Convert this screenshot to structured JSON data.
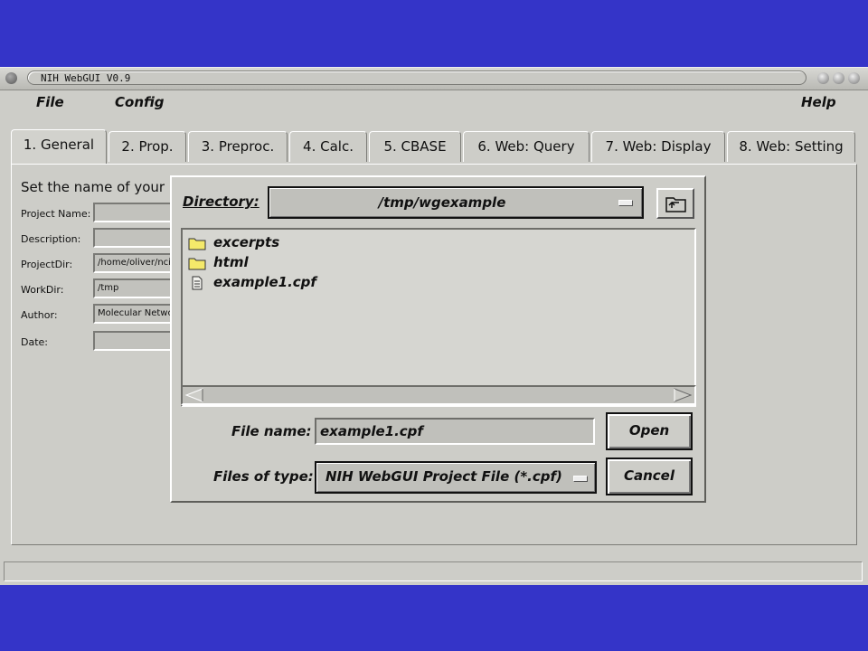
{
  "window": {
    "title": "NIH WebGUI V0.9"
  },
  "menubar": {
    "file": "File",
    "config": "Config",
    "help": "Help"
  },
  "tabs": [
    {
      "label": "1. General"
    },
    {
      "label": "2. Prop."
    },
    {
      "label": "3. Preproc."
    },
    {
      "label": "4. Calc."
    },
    {
      "label": "5. CBASE"
    },
    {
      "label": "6. Web: Query"
    },
    {
      "label": "7. Web: Display"
    },
    {
      "label": "8. Web: Setting"
    }
  ],
  "general": {
    "intro": "Set the name of your",
    "fields": [
      {
        "label": "Project Name:",
        "value": ""
      },
      {
        "label": "Description:",
        "value": ""
      },
      {
        "label": "ProjectDir:",
        "value": "/home/oliver/nci"
      },
      {
        "label": "WorkDir:",
        "value": "/tmp"
      },
      {
        "label": "Author:",
        "value": "Molecular Netwo"
      },
      {
        "label": "Date:",
        "value": ""
      }
    ]
  },
  "dialog": {
    "directory_label": "Directory:",
    "directory_value": "/tmp/wgexample",
    "files": [
      {
        "name": "excerpts",
        "icon": "folder-icon"
      },
      {
        "name": "html",
        "icon": "folder-icon"
      },
      {
        "name": "example1.cpf",
        "icon": "document-icon"
      }
    ],
    "filename_label": "File name:",
    "filename_value": "example1.cpf",
    "filetype_label": "Files of type:",
    "filetype_value": "NIH WebGUI Project File (*.cpf)",
    "open_label": "Open",
    "cancel_label": "Cancel"
  }
}
